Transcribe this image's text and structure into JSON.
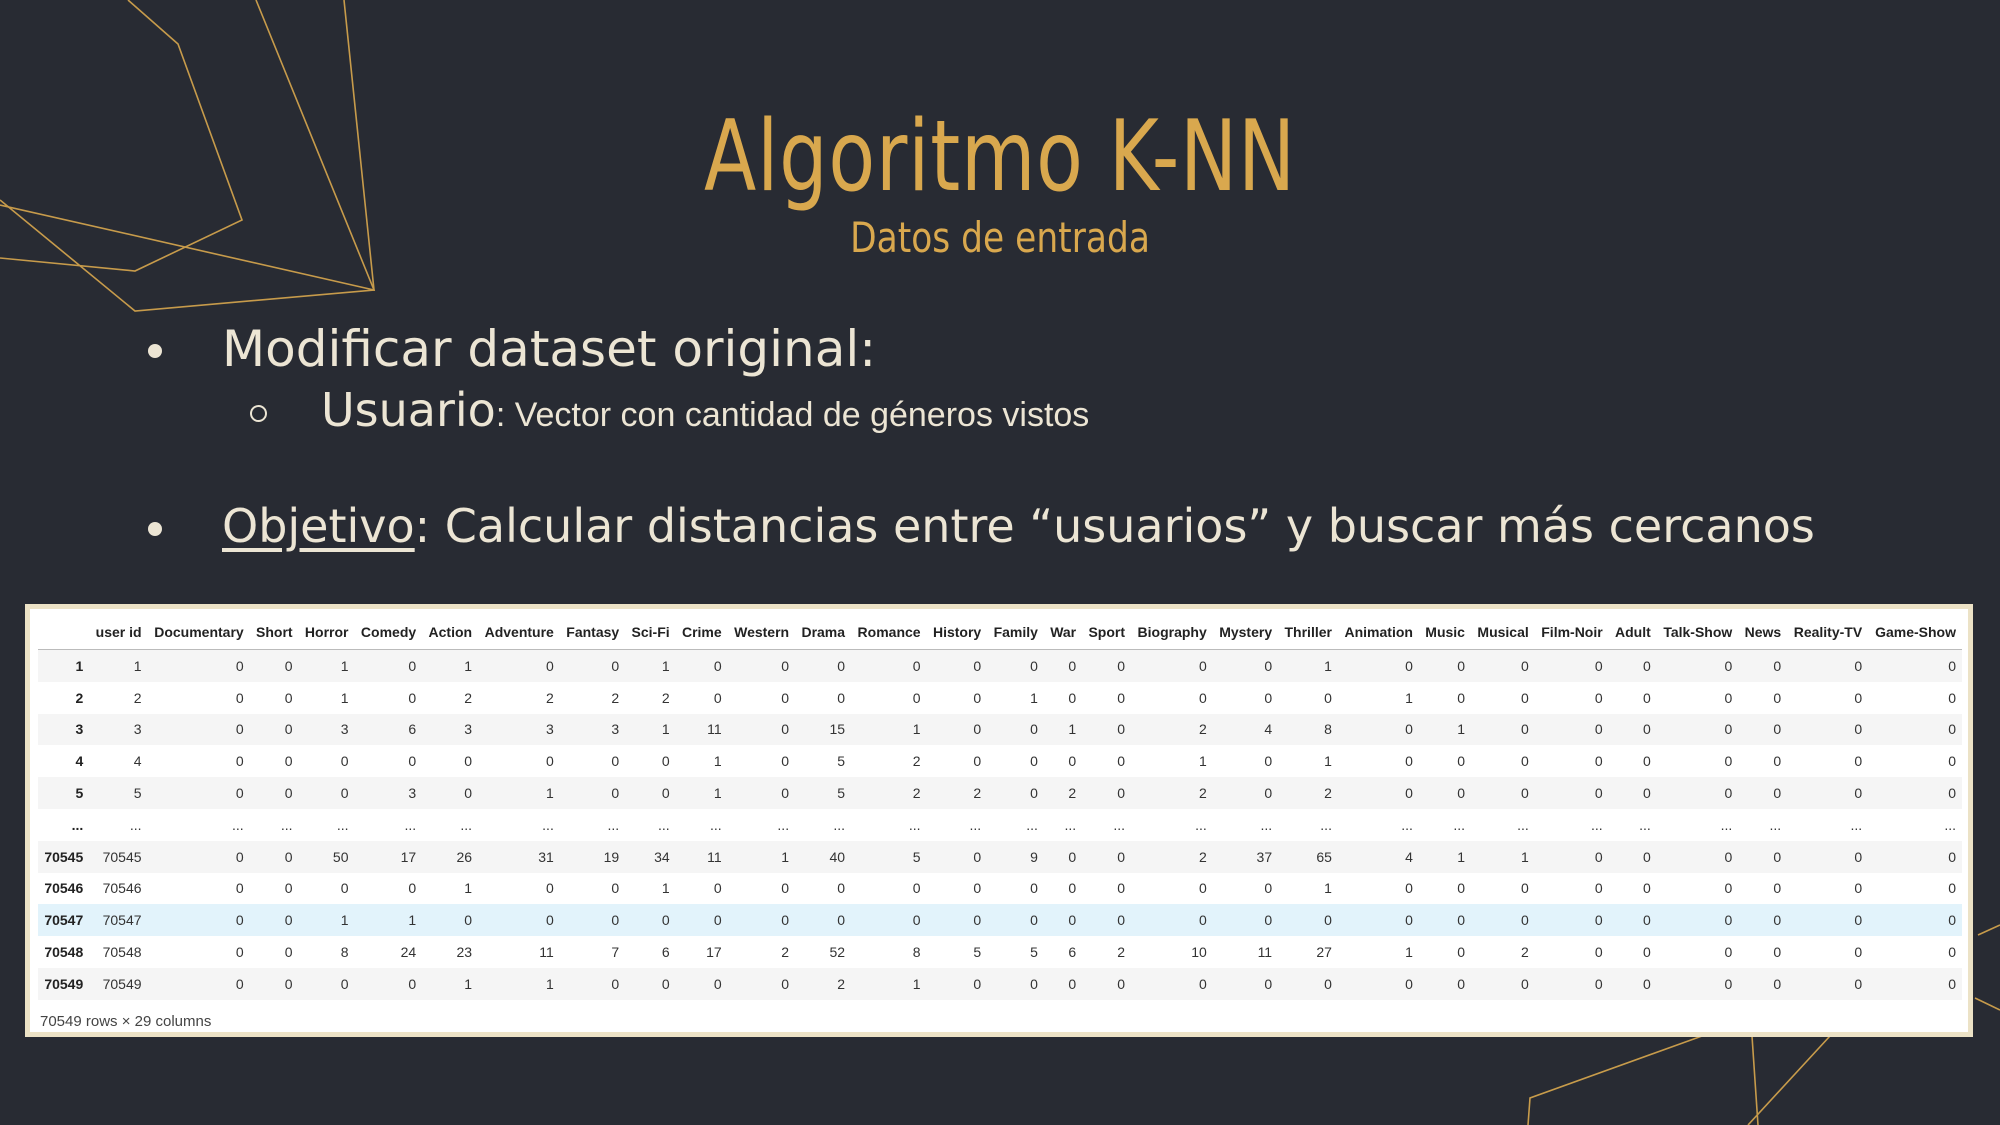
{
  "title": "Algoritmo K-NN",
  "subtitle": "Datos de entrada",
  "bullets": {
    "b1": "Modificar dataset original:",
    "b2_bold": "Usuario",
    "b2_rest": ": Vector con cantidad de géneros vistos",
    "b3_underlined": "Objetivo",
    "b3_rest": ": Calcular distancias entre “usuarios” y buscar más cercanos"
  },
  "colors": {
    "background": "#282b33",
    "accent": "#d9a84e",
    "text": "#ece5d4"
  },
  "table": {
    "columns": [
      "",
      "user id",
      "Documentary",
      "Short",
      "Horror",
      "Comedy",
      "Action",
      "Adventure",
      "Fantasy",
      "Sci-Fi",
      "Crime",
      "Western",
      "Drama",
      "Romance",
      "History",
      "Family",
      "War",
      "Sport",
      "Biography",
      "Mystery",
      "Thriller",
      "Animation",
      "Music",
      "Musical",
      "Film-Noir",
      "Adult",
      "Talk-Show",
      "News",
      "Reality-TV",
      "Game-Show"
    ],
    "rows": [
      [
        "1",
        "1",
        "0",
        "0",
        "1",
        "0",
        "1",
        "0",
        "0",
        "1",
        "0",
        "0",
        "0",
        "0",
        "0",
        "0",
        "0",
        "0",
        "0",
        "0",
        "1",
        "0",
        "0",
        "0",
        "0",
        "0",
        "0",
        "0",
        "0",
        "0"
      ],
      [
        "2",
        "2",
        "0",
        "0",
        "1",
        "0",
        "2",
        "2",
        "2",
        "2",
        "0",
        "0",
        "0",
        "0",
        "0",
        "1",
        "0",
        "0",
        "0",
        "0",
        "0",
        "1",
        "0",
        "0",
        "0",
        "0",
        "0",
        "0",
        "0",
        "0"
      ],
      [
        "3",
        "3",
        "0",
        "0",
        "3",
        "6",
        "3",
        "3",
        "3",
        "1",
        "11",
        "0",
        "15",
        "1",
        "0",
        "0",
        "1",
        "0",
        "2",
        "4",
        "8",
        "0",
        "1",
        "0",
        "0",
        "0",
        "0",
        "0",
        "0",
        "0"
      ],
      [
        "4",
        "4",
        "0",
        "0",
        "0",
        "0",
        "0",
        "0",
        "0",
        "0",
        "1",
        "0",
        "5",
        "2",
        "0",
        "0",
        "0",
        "0",
        "1",
        "0",
        "1",
        "0",
        "0",
        "0",
        "0",
        "0",
        "0",
        "0",
        "0",
        "0"
      ],
      [
        "5",
        "5",
        "0",
        "0",
        "0",
        "3",
        "0",
        "1",
        "0",
        "0",
        "1",
        "0",
        "5",
        "2",
        "2",
        "0",
        "2",
        "0",
        "2",
        "0",
        "2",
        "0",
        "0",
        "0",
        "0",
        "0",
        "0",
        "0",
        "0",
        "0"
      ],
      [
        "...",
        "...",
        "...",
        "...",
        "...",
        "...",
        "...",
        "...",
        "...",
        "...",
        "...",
        "...",
        "...",
        "...",
        "...",
        "...",
        "...",
        "...",
        "...",
        "...",
        "...",
        "...",
        "...",
        "...",
        "...",
        "...",
        "...",
        "...",
        "...",
        "..."
      ],
      [
        "70545",
        "70545",
        "0",
        "0",
        "50",
        "17",
        "26",
        "31",
        "19",
        "34",
        "11",
        "1",
        "40",
        "5",
        "0",
        "9",
        "0",
        "0",
        "2",
        "37",
        "65",
        "4",
        "1",
        "1",
        "0",
        "0",
        "0",
        "0",
        "0",
        "0"
      ],
      [
        "70546",
        "70546",
        "0",
        "0",
        "0",
        "0",
        "1",
        "0",
        "0",
        "1",
        "0",
        "0",
        "0",
        "0",
        "0",
        "0",
        "0",
        "0",
        "0",
        "0",
        "1",
        "0",
        "0",
        "0",
        "0",
        "0",
        "0",
        "0",
        "0",
        "0"
      ],
      [
        "70547",
        "70547",
        "0",
        "0",
        "1",
        "1",
        "0",
        "0",
        "0",
        "0",
        "0",
        "0",
        "0",
        "0",
        "0",
        "0",
        "0",
        "0",
        "0",
        "0",
        "0",
        "0",
        "0",
        "0",
        "0",
        "0",
        "0",
        "0",
        "0",
        "0"
      ],
      [
        "70548",
        "70548",
        "0",
        "0",
        "8",
        "24",
        "23",
        "11",
        "7",
        "6",
        "17",
        "2",
        "52",
        "8",
        "5",
        "5",
        "6",
        "2",
        "10",
        "11",
        "27",
        "1",
        "0",
        "2",
        "0",
        "0",
        "0",
        "0",
        "0",
        "0"
      ],
      [
        "70549",
        "70549",
        "0",
        "0",
        "0",
        "0",
        "1",
        "1",
        "0",
        "0",
        "0",
        "0",
        "2",
        "1",
        "0",
        "0",
        "0",
        "0",
        "0",
        "0",
        "0",
        "0",
        "0",
        "0",
        "0",
        "0",
        "0",
        "0",
        "0",
        "0"
      ]
    ],
    "highlighted_row": 8,
    "footer": "70549 rows × 29 columns"
  }
}
